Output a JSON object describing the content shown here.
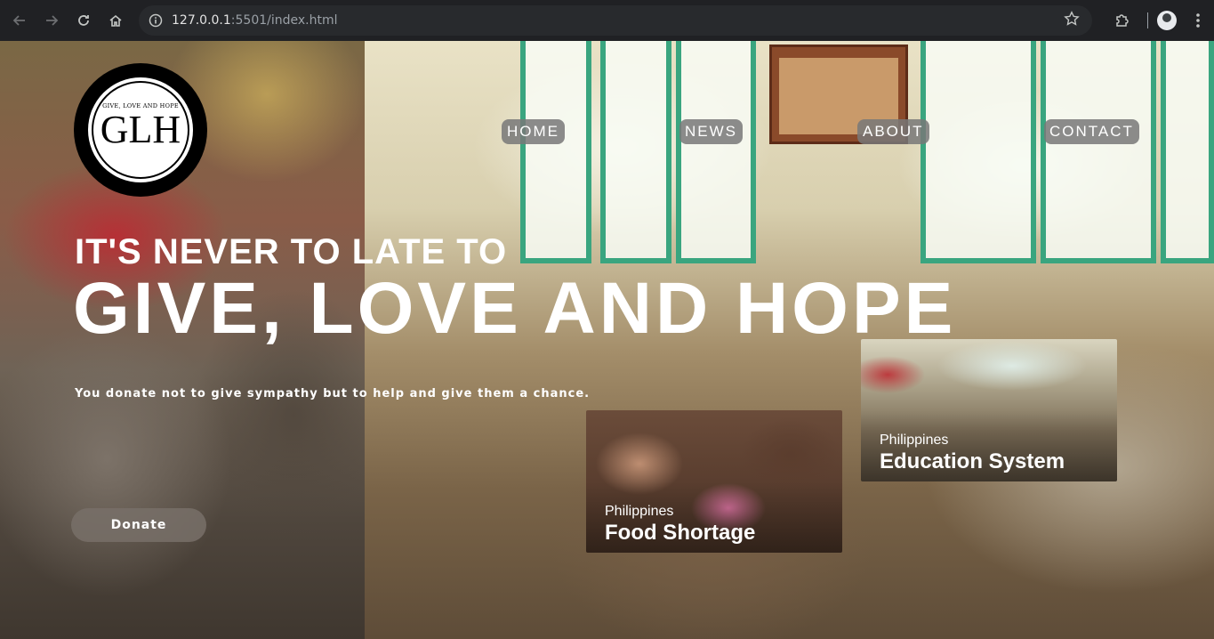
{
  "browser": {
    "url_host": "127.0.0.1",
    "url_rest": ":5501/index.html"
  },
  "logo": {
    "tagline": "GIVE, LOVE AND HOPE",
    "mark": "GLH"
  },
  "nav": {
    "items": [
      {
        "label": "HOME"
      },
      {
        "label": "NEWS"
      },
      {
        "label": "ABOUT"
      },
      {
        "label": "CONTACT"
      }
    ]
  },
  "hero": {
    "tagline": "IT'S NEVER TO LATE TO",
    "headline": "GIVE, LOVE AND HOPE",
    "subline": "You donate not to give sympathy but to help and give them a chance.",
    "donate_label": "Donate"
  },
  "cards": [
    {
      "country": "Philippines",
      "title": "Food Shortage"
    },
    {
      "country": "Philippines",
      "title": "Education System"
    }
  ],
  "colors": {
    "browser_bg": "#202124",
    "omnibox_bg": "#282a2d",
    "nav_button_bg": "#787878",
    "donate_bg": "#787068",
    "window_frame": "#3aa57f"
  }
}
